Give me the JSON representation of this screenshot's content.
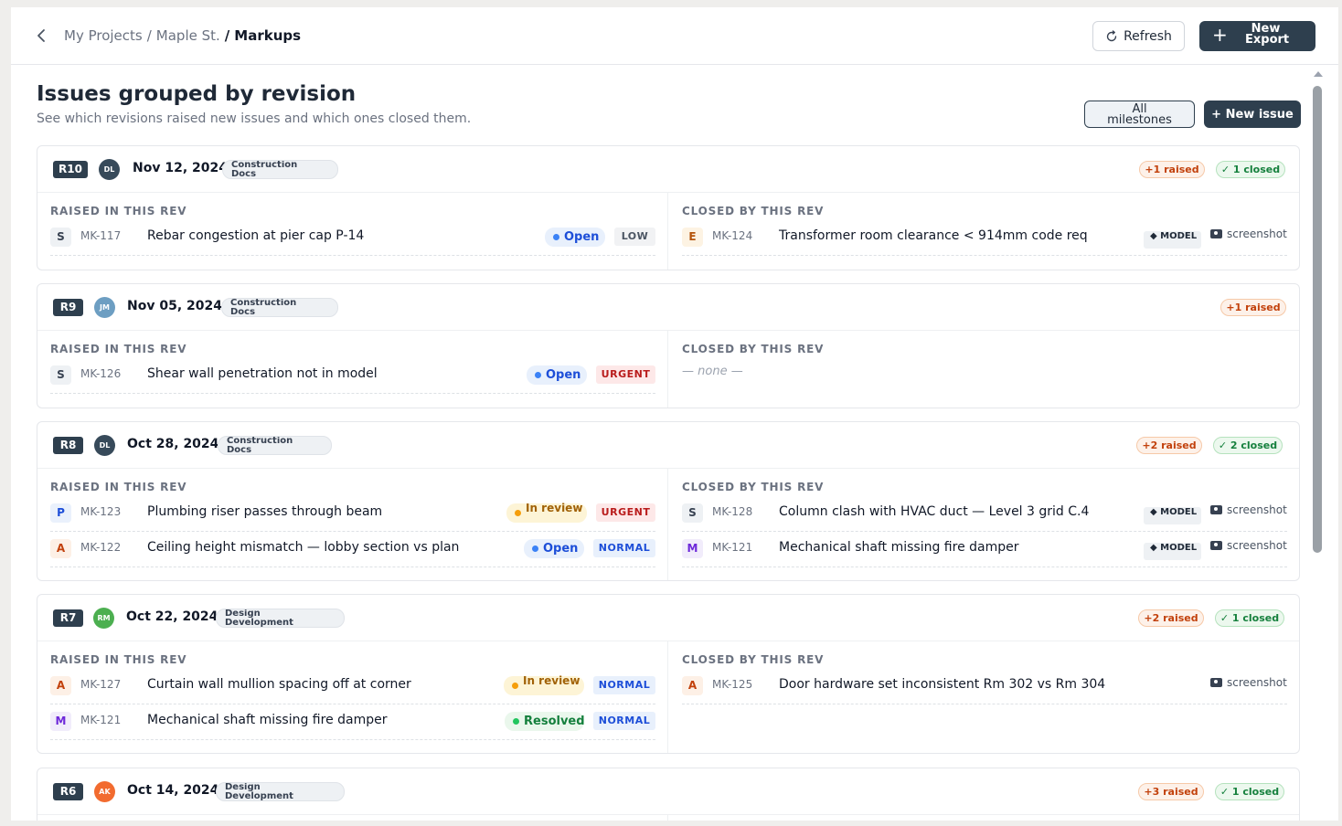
{
  "breadcrumb": {
    "items": [
      "My Projects",
      "Maple St."
    ],
    "current": "Markups",
    "separator": "/"
  },
  "actions": {
    "refresh": "Refresh",
    "new_export_line1": "New",
    "new_export_line2": "Export"
  },
  "page": {
    "title": "Issues grouped by revision",
    "subtitle": "See which revisions raised new issues and which ones closed them.",
    "milestones_line1": "All",
    "milestones_line2": "milestones",
    "new_issue": "+ New issue"
  },
  "labels": {
    "raised": "RAISED IN THIS REV",
    "closed": "CLOSED BY THIS REV",
    "none": "— none —",
    "model": "◆ MODEL",
    "screenshot": "screenshot"
  },
  "revisions": [
    {
      "rev": "R10",
      "initials": "DL",
      "avatar_color": "#374a5a",
      "date": "Nov 12, 2024",
      "phase": "Construction Docs",
      "raised_chip": "+1 raised",
      "closed_chip": "✓ 1 closed",
      "raised": [
        {
          "trade": "S",
          "id": "MK-117",
          "title": "Rebar congestion at pier cap P-14",
          "status": "Open",
          "priority": "LOW"
        }
      ],
      "closed": [
        {
          "trade": "E",
          "id": "MK-124",
          "title": "Transformer room clearance < 914mm code req",
          "model": true,
          "screenshot": true
        }
      ]
    },
    {
      "rev": "R9",
      "initials": "JM",
      "avatar_color": "#6d9ec2",
      "date": "Nov 05, 2024",
      "phase": "Construction Docs",
      "raised_chip": "+1 raised",
      "raised": [
        {
          "trade": "S",
          "id": "MK-126",
          "title": "Shear wall penetration not in model",
          "status": "Open",
          "priority": "URGENT"
        }
      ],
      "closed": []
    },
    {
      "rev": "R8",
      "initials": "DL",
      "avatar_color": "#374a5a",
      "date": "Oct 28, 2024",
      "phase": "Construction Docs",
      "raised_chip": "+2 raised",
      "closed_chip": "✓ 2 closed",
      "raised": [
        {
          "trade": "P",
          "id": "MK-123",
          "title": "Plumbing riser passes through beam",
          "status": "In review",
          "priority": "URGENT"
        },
        {
          "trade": "A",
          "id": "MK-122",
          "title": "Ceiling height mismatch — lobby section vs plan",
          "status": "Open",
          "priority": "NORMAL"
        }
      ],
      "closed": [
        {
          "trade": "S",
          "id": "MK-128",
          "title": "Column clash with HVAC duct — Level 3 grid C.4",
          "model": true,
          "screenshot": true
        },
        {
          "trade": "M",
          "id": "MK-121",
          "title": "Mechanical shaft missing fire damper",
          "model": true,
          "screenshot": true
        }
      ]
    },
    {
      "rev": "R7",
      "initials": "RM",
      "avatar_color": "#4caf50",
      "date": "Oct 22, 2024",
      "phase": "Design Development",
      "raised_chip": "+2 raised",
      "closed_chip": "✓ 1 closed",
      "raised": [
        {
          "trade": "A",
          "id": "MK-127",
          "title": "Curtain wall mullion spacing off at corner",
          "status": "In review",
          "priority": "NORMAL"
        },
        {
          "trade": "M",
          "id": "MK-121",
          "title": "Mechanical shaft missing fire damper",
          "status": "Resolved",
          "priority": "NORMAL"
        }
      ],
      "closed": [
        {
          "trade": "A",
          "id": "MK-125",
          "title": "Door hardware set inconsistent Rm 302 vs Rm 304",
          "model": false,
          "screenshot": true
        }
      ]
    },
    {
      "rev": "R6",
      "initials": "AK",
      "avatar_color": "#f26b2f",
      "date": "Oct 14, 2024",
      "phase": "Design Development",
      "raised_chip": "+3 raised",
      "closed_chip": "✓ 1 closed",
      "raised": [],
      "closed": []
    }
  ]
}
